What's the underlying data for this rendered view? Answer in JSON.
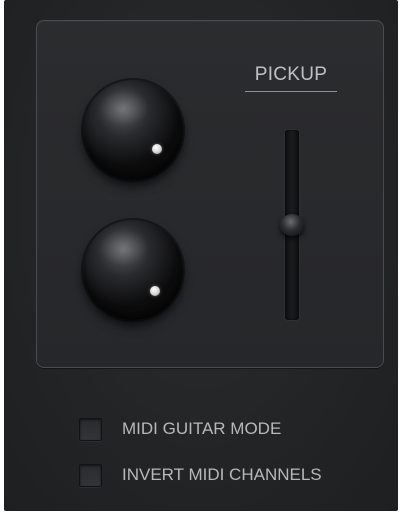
{
  "pickup_panel": {
    "title": "PICKUP",
    "knobs": [
      {
        "name": "upper-knob"
      },
      {
        "name": "lower-knob"
      }
    ],
    "slider": {
      "value": 0.5
    }
  },
  "options": [
    {
      "label": "MIDI GUITAR MODE",
      "checked": false
    },
    {
      "label": "INVERT MIDI CHANNELS",
      "checked": false
    }
  ],
  "colors": {
    "background": "#232426",
    "panel_border": "#4a4b4e",
    "label_text": "#b7b8ba"
  }
}
